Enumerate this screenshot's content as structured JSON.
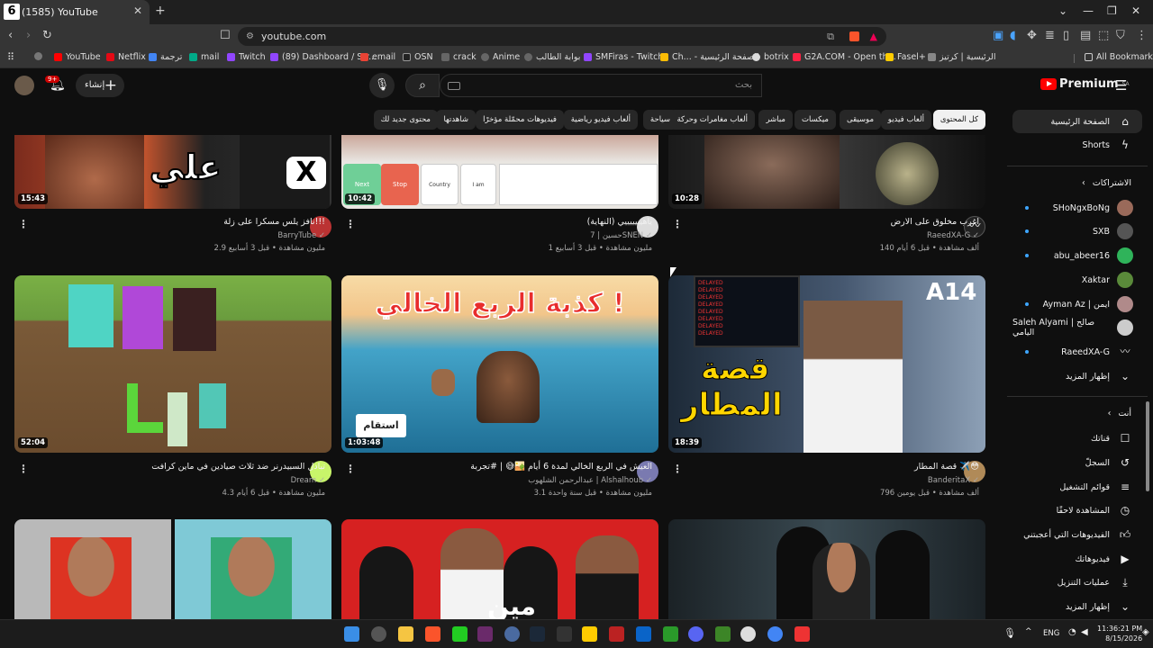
{
  "browser": {
    "tab_title": "(1585) YouTube",
    "new_tab": "+",
    "url": "youtube.com",
    "bookmarks": [
      "YouTube",
      "Netflix",
      "ترجمة",
      "mail",
      "Twitch",
      "(89) Dashboard / Str...",
      "email",
      "OSN",
      "crack",
      "Anime",
      "بوابة الطالب",
      "SMFiras - Twitch",
      "Ch... - الصفحة الرئيسية",
      "botrix",
      "G2A.COM - Open th...",
      "Fasel+",
      "الرئيسية | كرتيز"
    ],
    "all_bookmarks": "All Bookmarks"
  },
  "header": {
    "logo": "Premium",
    "logo_region": "SA",
    "search_placeholder": "بحث",
    "create_label": "إنشاء",
    "notif_count": "9+"
  },
  "chips": [
    "كل المحتوى",
    "ألعاب فيديو",
    "موسيقى",
    "ميكسات",
    "مباشر",
    "ألعاب مغامرات وحركة",
    "سياحة",
    "ألعاب فيديو رياضية",
    "فيديوهات محمّلة مؤخرًا",
    "شاهدتها",
    "محتوى جديد لك"
  ],
  "videos": [
    {
      "title": "نافز يلس مسكرا على زلة!!!",
      "channel": "BarryTube",
      "meta": "2.9 مليون مشاهدة • قبل 3 أسابيع",
      "duration": "15:43"
    },
    {
      "title": "ياهيييييييي (النهاية)",
      "channel": "حسين | 7SNEN",
      "meta": "1 مليون مشاهدة • قبل 3 أسابيع",
      "duration": "10:42"
    },
    {
      "title": "اغرب مخلوق على الارض",
      "channel": "RaeedXA-G",
      "meta": "140 ألف مشاهدة • قبل 6 أيام",
      "duration": "10:28"
    },
    {
      "title": "تبادل السبيدرنر ضد ثلاث صيادين في ماين كرافت",
      "channel": "Dream",
      "meta": "4.3 مليون مشاهدة • قبل 6 أيام",
      "duration": "52:04"
    },
    {
      "title": "العيش في الربع الخالي لمدة 6 أيام 🏜️😅 | #تجربة",
      "channel": "عبدالرحمن الشلهوب | Alshalhoub",
      "meta": "3.1 مليون مشاهدة • قبل سنة واحدة",
      "duration": "1:03:48"
    },
    {
      "title": "قصة المطار ✈️😳",
      "channel": "BanderitaX",
      "meta": "796 ألف مشاهدة • قبل يومين",
      "duration": "18:39"
    }
  ],
  "thumb_text": {
    "t1": "علي",
    "t5": "كذبة الربع الخالي !",
    "t5b": "استقام",
    "t6a": "قصة",
    "t6b": "المطار",
    "t6c": "A14",
    "t8": "مين"
  },
  "sidebar": {
    "home": "الصفحة الرئيسية",
    "shorts": "Shorts",
    "subs_header": "الاشتراكات",
    "subs": [
      "SHoNgxBoNg",
      "SXB",
      "abu_abeer16",
      "Xaktar",
      "Ayman Az | ايمن",
      "Saleh Alyami | صالح اليامي",
      "RaeedXA-G"
    ],
    "show_more": "إظهار المزيد",
    "you_header": "أنت",
    "you": [
      "قناتك",
      "السجلّ",
      "قوائم التشغيل",
      "المشاهدة لاحقًا",
      "الفيديوهات التي أعجبتني",
      "فيديوهاتك",
      "عمليات التنزيل",
      "إظهار المزيد"
    ]
  },
  "taskbar": {
    "lang": "ENG",
    "time": "11:36:21 PM",
    "date": "8/15/2026"
  }
}
